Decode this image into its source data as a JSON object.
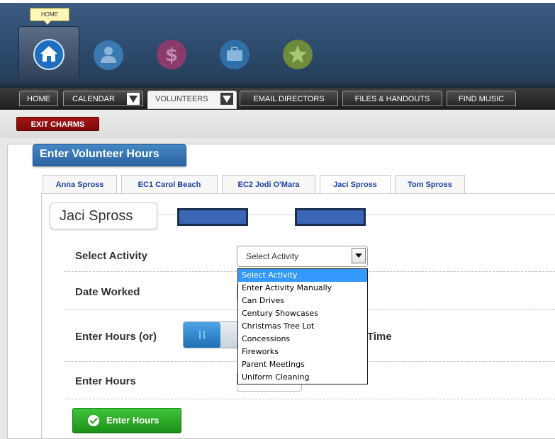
{
  "header": {
    "tooltip": "HOME",
    "icons": [
      "home-icon",
      "person-icon",
      "dollar-icon",
      "briefcase-icon",
      "star-icon"
    ]
  },
  "nav_tabs": [
    {
      "label": "HOME"
    },
    {
      "label": "CALENDAR"
    },
    {
      "label": "VOLUNTEERS"
    },
    {
      "label": "EMAIL DIRECTORS"
    },
    {
      "label": "FILES & HANDOUTS"
    },
    {
      "label": "FIND MUSIC"
    }
  ],
  "exit_button": "EXIT CHARMS",
  "panel": {
    "title": "Enter Volunteer Hours",
    "person_tabs": [
      "Anna Spross",
      "EC1 Carol Beach",
      "EC2 Jodi O'Mara",
      "Jaci Spross",
      "Tom Spross"
    ],
    "active_tab": "Jaci Spross",
    "selected_person": "Jaci Spross"
  },
  "form": {
    "select_activity_label": "Select Activity",
    "select_value": "Select Activity",
    "date_worked_label": "Date Worked",
    "enter_hours_or_label": "Enter Hours (or)",
    "time_label_partial": "Time",
    "enter_hours_label": "Enter Hours",
    "submit_label": "Enter Hours"
  },
  "dropdown_options": [
    "Select Activity",
    "Enter Activity Manually",
    "Can Drives",
    "Century Showcases",
    "Christmas Tree Lot",
    "Concessions",
    "Fireworks",
    "Parent Meetings",
    "Uniform Cleaning"
  ],
  "colors": {
    "header": "#2d4a6c",
    "exit": "#9a1212",
    "title": "#3677b8",
    "tab_text": "#1d3fa6",
    "highlight": "#3399ff",
    "submit": "#2aa825"
  }
}
